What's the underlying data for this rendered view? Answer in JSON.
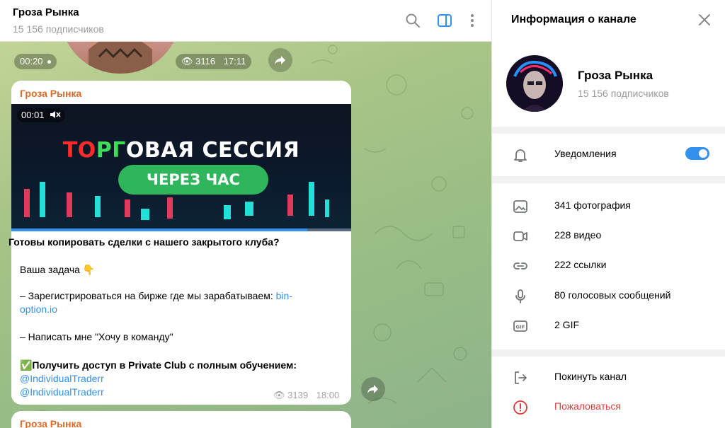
{
  "chat": {
    "title": "Гроза Рынка",
    "subscribers": "15 156 подписчиков",
    "prev_message": {
      "duration": "00:20",
      "views": "3116",
      "time": "17:11"
    },
    "message": {
      "sender": "Гроза Рынка",
      "video": {
        "timer": "00:01",
        "title_red": "ТО",
        "title_green": "РГ",
        "title_rest": "ОВАЯ СЕССИЯ",
        "badge": "ЧЕРЕЗ ЧАС",
        "progress": 0.87
      },
      "line1": "Готовы копировать сделки с нашего закрытого клуба?",
      "line2": "Ваша задача 👇",
      "line3_prefix": "– Зарегистрироваться на бирже где мы зарабатываем: ",
      "line3_link": "bin-option.io",
      "line4": "– Написать мне \"Хочу в команду\"",
      "line5": "✅Получить доступ в Private Club с полным обучением:",
      "link1": "@IndividualTraderr",
      "link2": "@IndividualTraderr",
      "views": "3139",
      "time": "18:00"
    },
    "next_sender": "Гроза Рынка"
  },
  "info": {
    "panel_title": "Информация о канале",
    "channel_name": "Гроза Рынка",
    "channel_sub": "15 156 подписчиков",
    "notifications_label": "Уведомления",
    "notifications_on": true,
    "media": [
      {
        "label": "341 фотография",
        "icon": "photo-icon"
      },
      {
        "label": "228 видео",
        "icon": "video-icon"
      },
      {
        "label": "222 ссылки",
        "icon": "link-icon"
      },
      {
        "label": "80 голосовых сообщений",
        "icon": "microphone-icon"
      },
      {
        "label": "2 GIF",
        "icon": "gif-icon"
      }
    ],
    "leave_label": "Покинуть канал",
    "report_label": "Пожаловаться"
  },
  "colors": {
    "accent": "#3390ec",
    "sender": "#d86a2a",
    "danger": "#e53935"
  }
}
